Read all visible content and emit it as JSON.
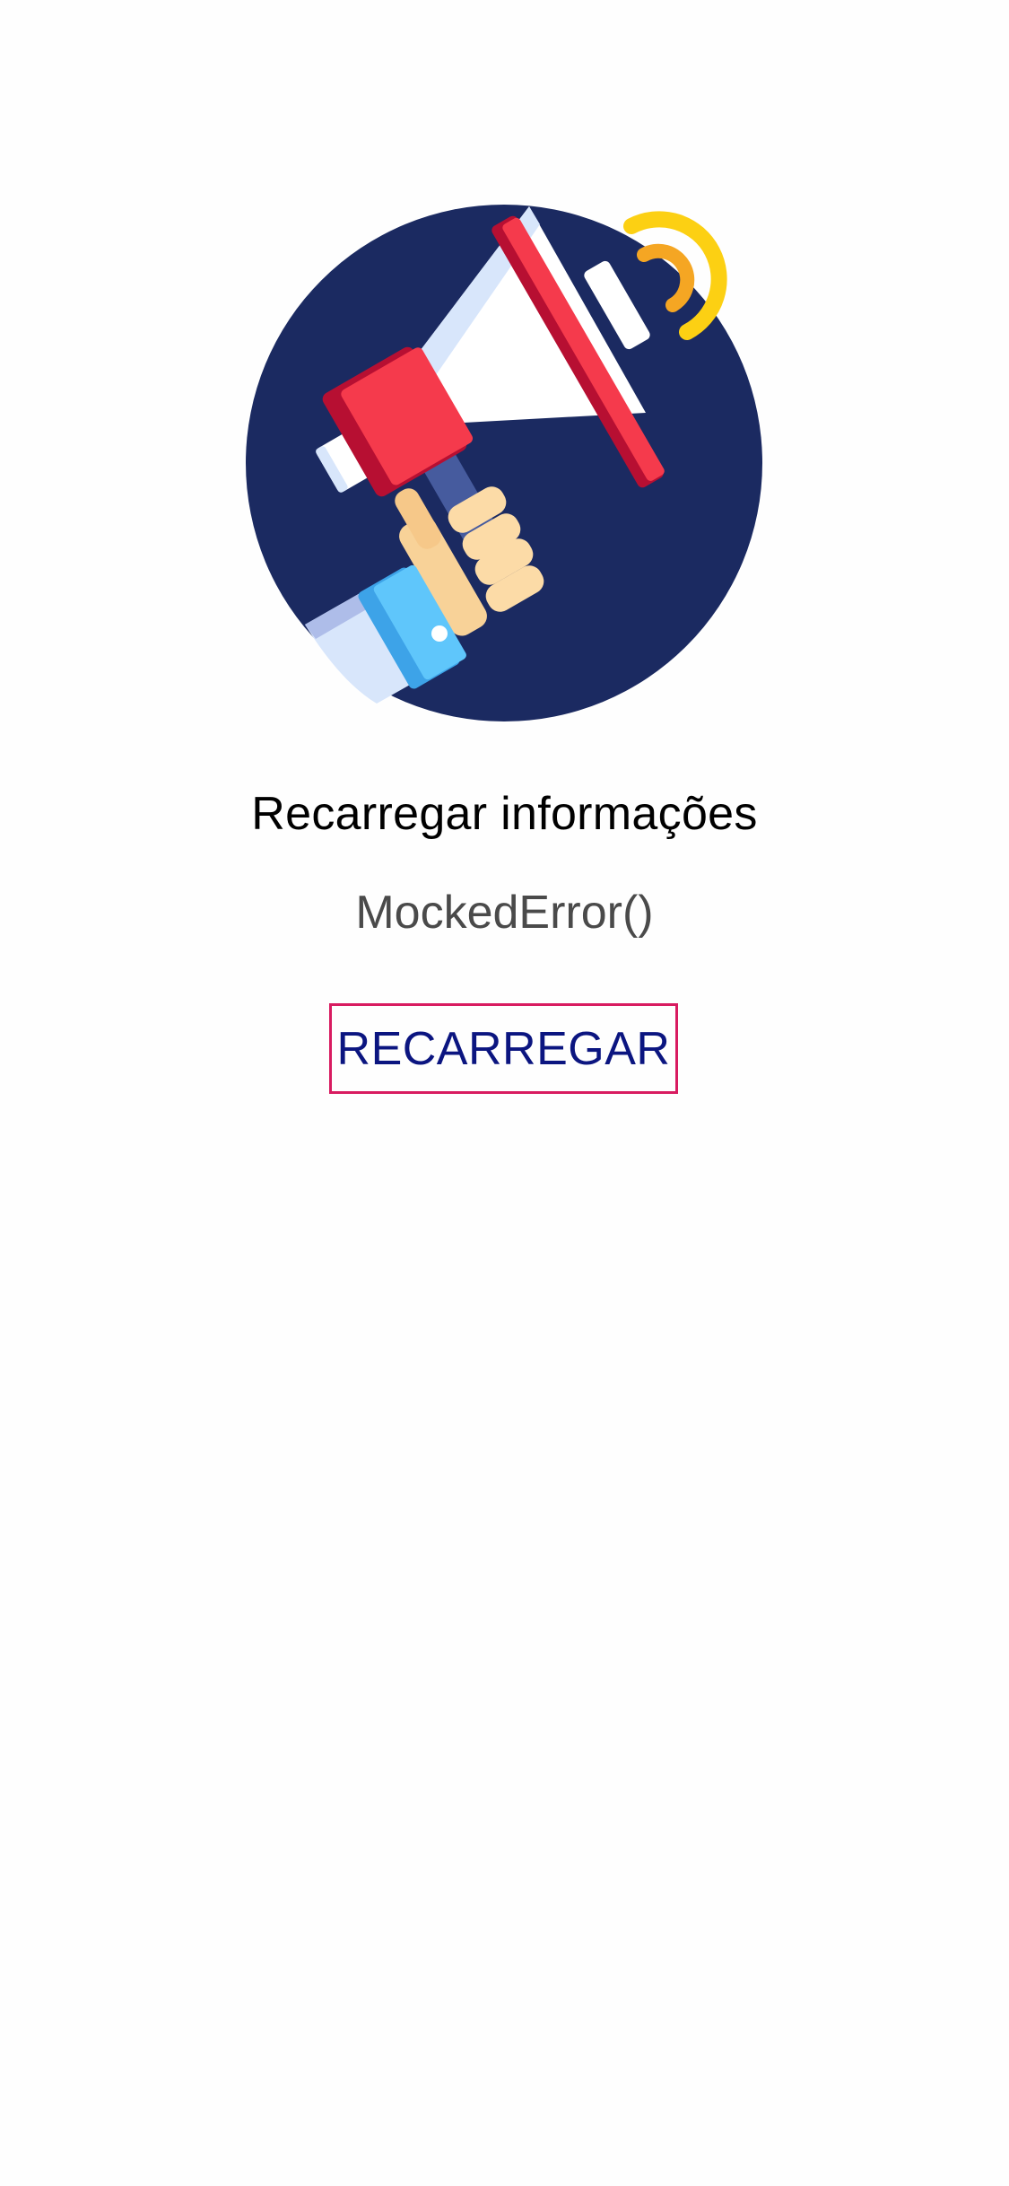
{
  "error_screen": {
    "illustration_icon": "megaphone-icon",
    "title": "Recarregar informações",
    "message": "MockedError()",
    "reload_button_label": "RECARREGAR"
  },
  "colors": {
    "background": "#fefefe",
    "title_text": "#000000",
    "message_text": "#4a4a4a",
    "button_text": "#0b1580",
    "button_border": "#d81b60",
    "illustration_circle": "#1b2a61",
    "megaphone_red": "#f53a4c",
    "megaphone_dark_red": "#b70f32",
    "sound_waves_yellow": "#fcd013",
    "sound_waves_orange": "#f5a623",
    "sleeve_blue": "#5fc6fb"
  }
}
